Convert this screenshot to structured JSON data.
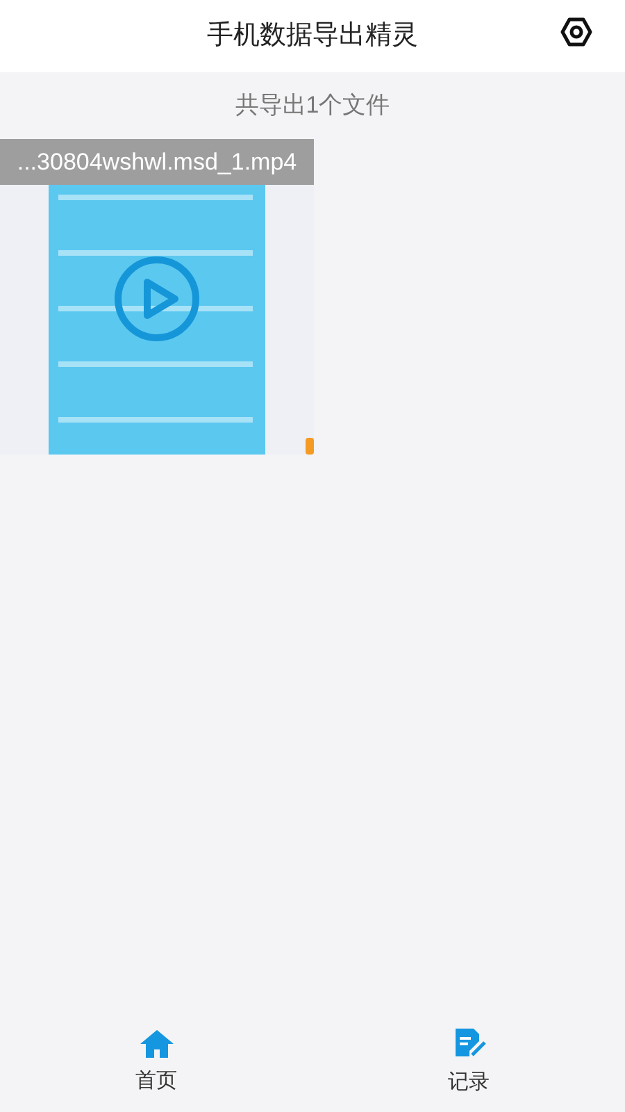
{
  "header": {
    "title": "手机数据导出精灵"
  },
  "summary": "共导出1个文件",
  "files": [
    {
      "kind": "video",
      "name": "...30804wshwl.msd_1.mp4"
    }
  ],
  "tabs": [
    {
      "label": "首页",
      "kind": "home"
    },
    {
      "label": "记录",
      "kind": "record"
    }
  ]
}
